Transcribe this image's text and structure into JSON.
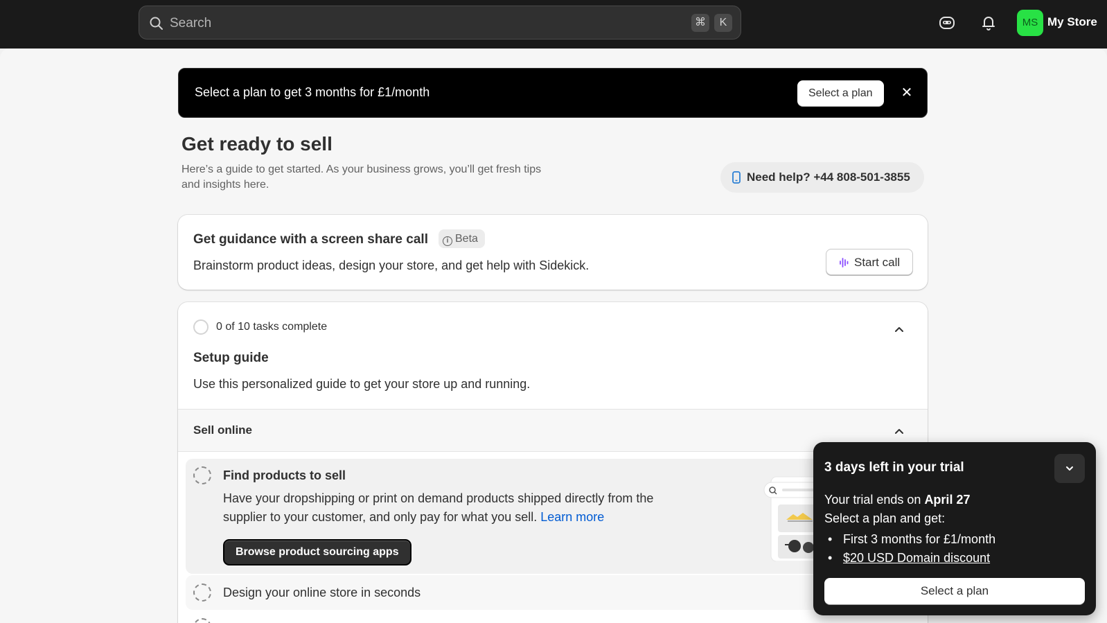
{
  "topbar": {
    "search_placeholder": "Search",
    "shortcut_keys": [
      "⌘",
      "K"
    ],
    "avatar_initials": "MS",
    "store_name": "My Store",
    "avatar_color": "#28e145"
  },
  "promo": {
    "text": "Select a plan to get 3 months for £1/month",
    "button": "Select a plan",
    "close": "✕"
  },
  "header": {
    "title": "Get ready to sell",
    "subtitle": "Here’s a guide to get started. As your business grows, you’ll get fresh tips and insights here.",
    "help": "Need help? +44 808-501-3855"
  },
  "call_card": {
    "title": "Get guidance with a screen share call",
    "badge": "Beta",
    "description": "Brainstorm product ideas, design your store, and get help with Sidekick.",
    "button": "Start call"
  },
  "setup_guide": {
    "progress": "0 of 10 tasks complete",
    "title": "Setup guide",
    "description": "Use this personalized guide to get your store up and running.",
    "section": "Sell online",
    "tasks": [
      {
        "title": "Find products to sell",
        "description": "Have your dropshipping or print on demand products shipped directly from the supplier to your customer, and only pay for what you sell.",
        "link": "Learn more",
        "button": "Browse product sourcing apps"
      },
      {
        "title": "Design your online store in seconds"
      }
    ]
  },
  "trial": {
    "title": "3 days left in your trial",
    "ends_prefix": "Your trial ends on ",
    "ends_date": "April 27",
    "select_intro": "Select a plan and get:",
    "benefits": [
      "First 3 months for £1/month",
      "$20 USD Domain discount"
    ],
    "button": "Select a plan"
  }
}
